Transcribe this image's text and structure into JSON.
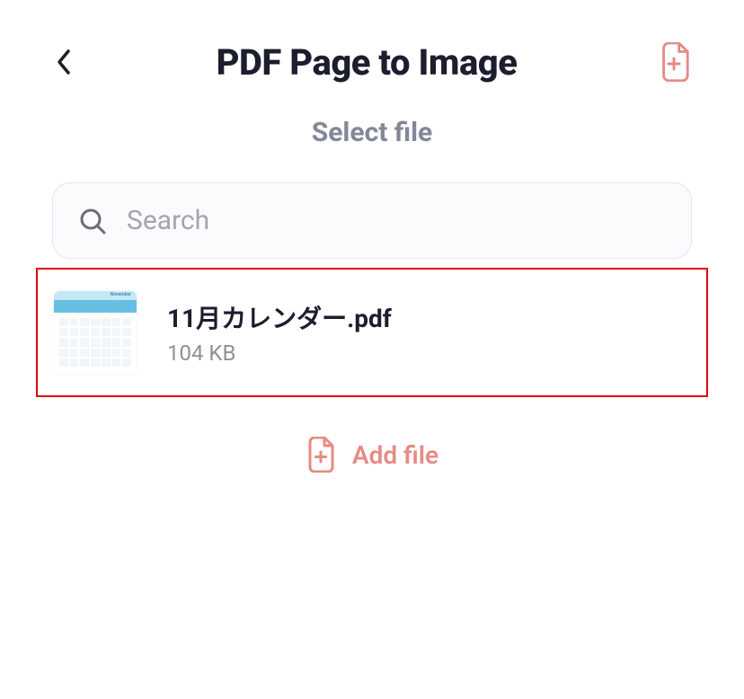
{
  "header": {
    "title": "PDF Page to Image"
  },
  "subtitle": "Select file",
  "search": {
    "placeholder": "Search",
    "value": ""
  },
  "files": [
    {
      "name": "11月カレンダー.pdf",
      "size": "104 KB",
      "thumb_label": "November"
    }
  ],
  "actions": {
    "add_file_label": "Add file"
  },
  "colors": {
    "accent": "#e58b86",
    "text_primary": "#1c1d2e",
    "text_muted": "#8e919b",
    "highlight_border": "#e3000f"
  }
}
